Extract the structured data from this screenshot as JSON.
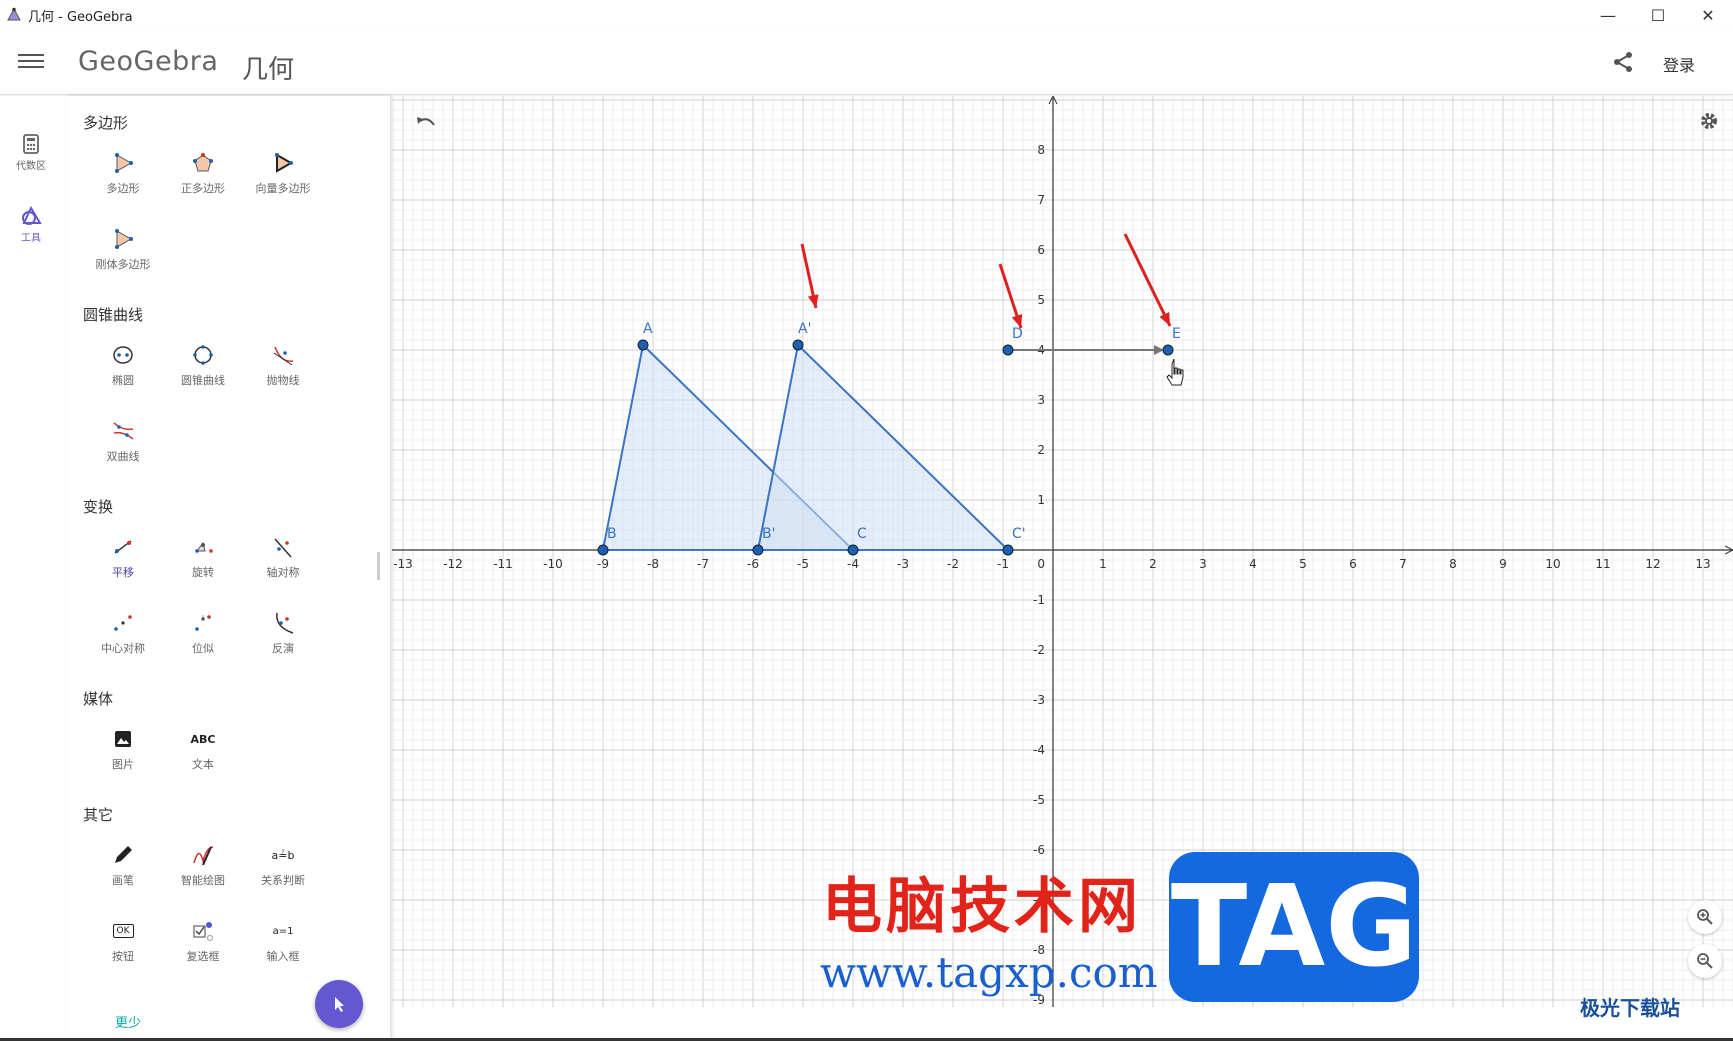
{
  "window": {
    "title": "几何 - GeoGebra",
    "controls": {
      "minimize": "—",
      "maximize": "☐",
      "close": "✕"
    }
  },
  "header": {
    "logo": "GeoGebra",
    "app_name": "几何",
    "login": "登录"
  },
  "rail": {
    "items": [
      {
        "label": "代数区",
        "icon": "calculator-icon"
      },
      {
        "label": "工具",
        "icon": "tools-icon"
      }
    ]
  },
  "tools_panel": {
    "sections": [
      {
        "title": "多边形",
        "tools": [
          "多边形",
          "正多边形",
          "向量多边形",
          "刚体多边形"
        ]
      },
      {
        "title": "圆锥曲线",
        "tools": [
          "椭圆",
          "圆锥曲线",
          "抛物线",
          "双曲线"
        ]
      },
      {
        "title": "变换",
        "tools": [
          "平移",
          "旋转",
          "轴对称",
          "中心对称",
          "位似",
          "反演"
        ]
      },
      {
        "title": "媒体",
        "tools": [
          "图片",
          "文本"
        ]
      },
      {
        "title": "其它",
        "tools": [
          "画笔",
          "智能绘图",
          "关系判断",
          "按钮",
          "复选框",
          "输入框"
        ]
      }
    ],
    "selected_tool": "平移",
    "less_label": "更少",
    "text_tool_icon_label": "ABC",
    "button_tool_icon_label": "OK",
    "relation_icon_label": "a≟b",
    "input_icon_label": "a=1"
  },
  "graphics": {
    "x_ticks": [
      "-13",
      "-12",
      "-11",
      "-10",
      "-9",
      "-8",
      "-7",
      "-6",
      "-5",
      "-4",
      "-3",
      "-2",
      "-1",
      "1",
      "2",
      "3",
      "4",
      "5",
      "6",
      "7",
      "8",
      "9",
      "10",
      "11",
      "12",
      "13"
    ],
    "y_ticks": [
      "8",
      "7",
      "6",
      "5",
      "4",
      "3",
      "2",
      "1",
      "-1",
      "-2",
      "-3",
      "-4",
      "-5",
      "-6",
      "-7",
      "-8",
      "-9"
    ],
    "origin_label": "0",
    "points": [
      {
        "label": "A",
        "x": -8.2,
        "y": 4.1
      },
      {
        "label": "B",
        "x": -9,
        "y": 0
      },
      {
        "label": "C",
        "x": -4,
        "y": 0
      },
      {
        "label": "A'",
        "x": -5.1,
        "y": 4.1
      },
      {
        "label": "B'",
        "x": -5.9,
        "y": 0
      },
      {
        "label": "C'",
        "x": -0.9,
        "y": 0
      },
      {
        "label": "D",
        "x": -0.9,
        "y": 4
      },
      {
        "label": "E",
        "x": 2.3,
        "y": 4
      }
    ],
    "colors": {
      "polygon_stroke": "#3a74c4",
      "polygon_fill": "#cfe0f3",
      "point": "#1f5fb0",
      "arrow": "#e02020",
      "vector": "#777777",
      "grid_minor": "#eeeeee",
      "grid_major": "#d0d0d0"
    }
  },
  "watermark": {
    "cn": "电脑技术网",
    "url": "www.tagxp.com",
    "tag": "TAG",
    "corner": "极光下载站"
  }
}
